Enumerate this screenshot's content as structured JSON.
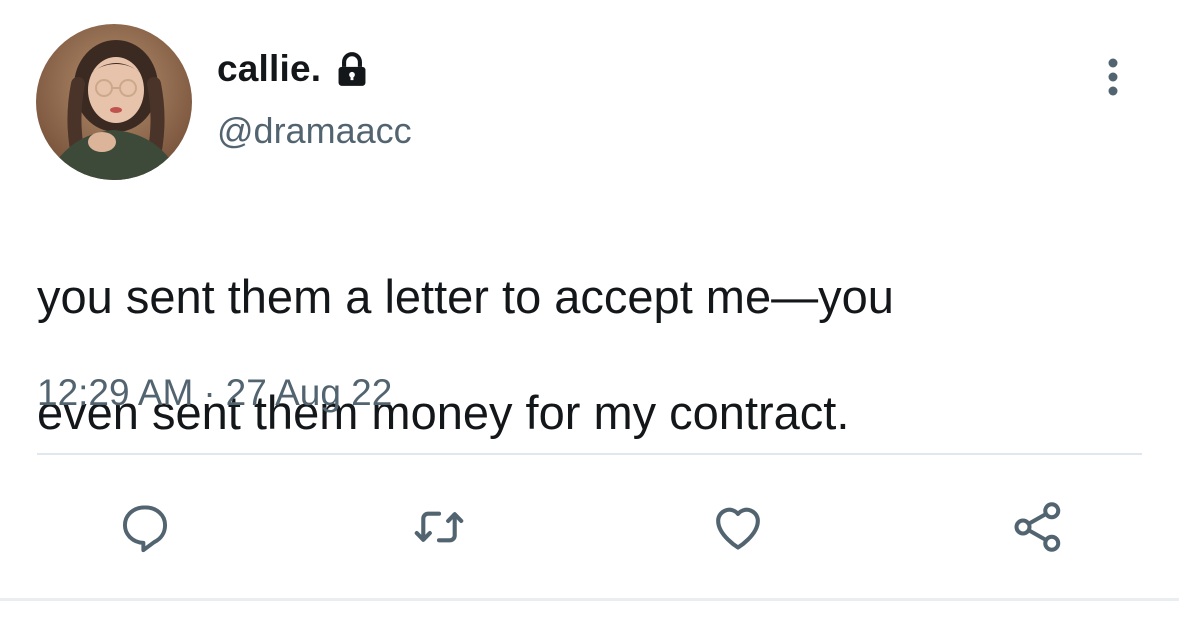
{
  "user": {
    "display_name": "callie.",
    "handle": "@dramaacc",
    "protected_icon": "lock-icon",
    "avatar": "profile-avatar"
  },
  "tweet": {
    "text_line1": "you sent them a letter to accept me—you",
    "text_line2": "even sent them money for my contract.",
    "time": "12:29 AM",
    "separator": "·",
    "date": "27 Aug 22"
  },
  "actions": [
    {
      "icon": "reply-icon"
    },
    {
      "icon": "retweet-icon"
    },
    {
      "icon": "like-icon"
    },
    {
      "icon": "share-icon"
    }
  ],
  "menu_icon": "more-vertical-icon",
  "colors": {
    "text_primary": "#14171a",
    "text_secondary": "#536471",
    "icon": "#536471",
    "divider": "#e1e8ed"
  }
}
